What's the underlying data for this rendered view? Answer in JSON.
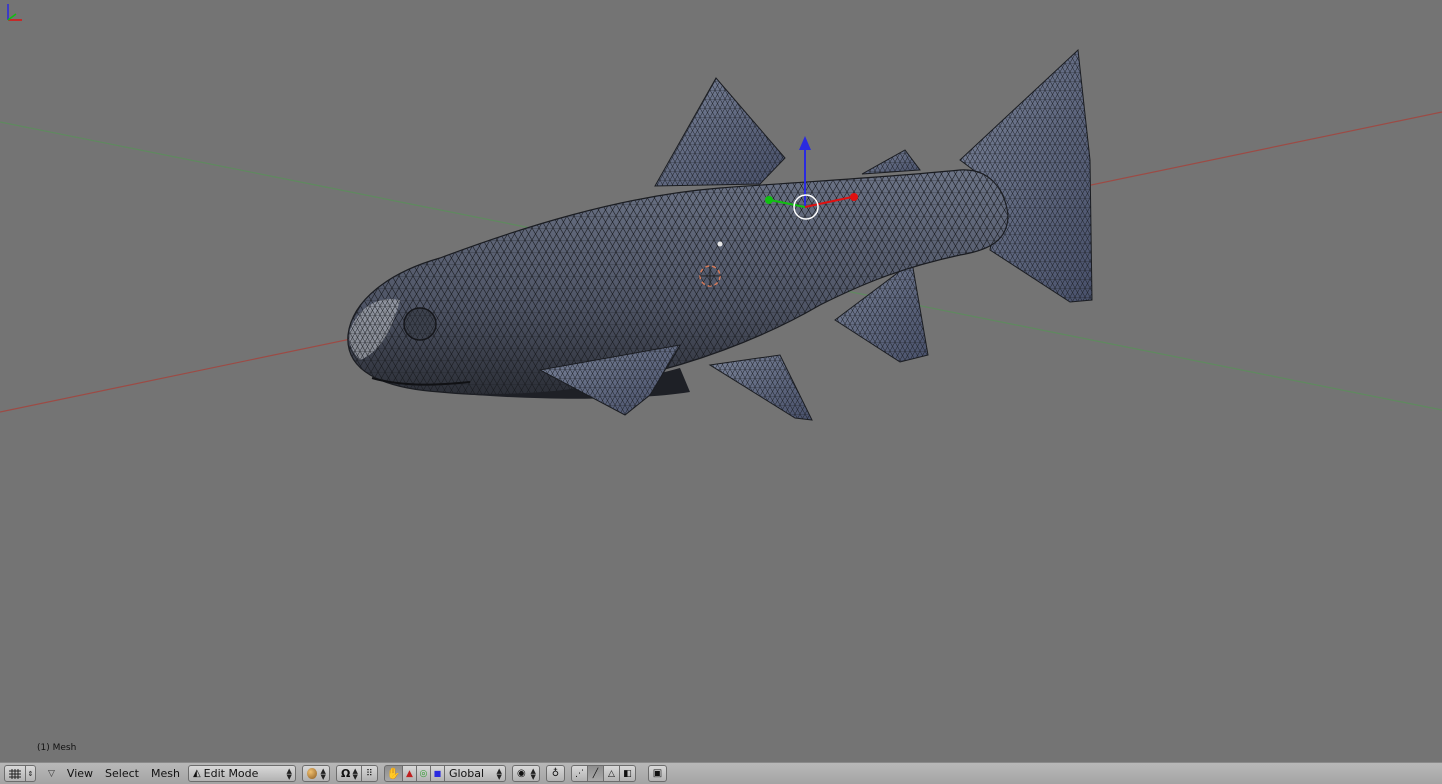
{
  "viewport": {
    "object_label": "(1) Mesh",
    "mode": "Edit Mode"
  },
  "header": {
    "editor_icon": "grid-icon",
    "menus": [
      "View",
      "Select",
      "Mesh"
    ],
    "mode_select": "Edit Mode",
    "orientation_select": "Global"
  },
  "colors": {
    "viewport_bg": "#747474",
    "header_bg": "#b0b0b0",
    "mesh_fill": "#5b6272",
    "mesh_wire": "#1b1d22",
    "axis_x": "#9c4b45",
    "axis_y": "#5f8a5f",
    "gizmo_z": "#2a2ae0",
    "gizmo_x": "#e01010",
    "gizmo_y": "#10c010"
  }
}
